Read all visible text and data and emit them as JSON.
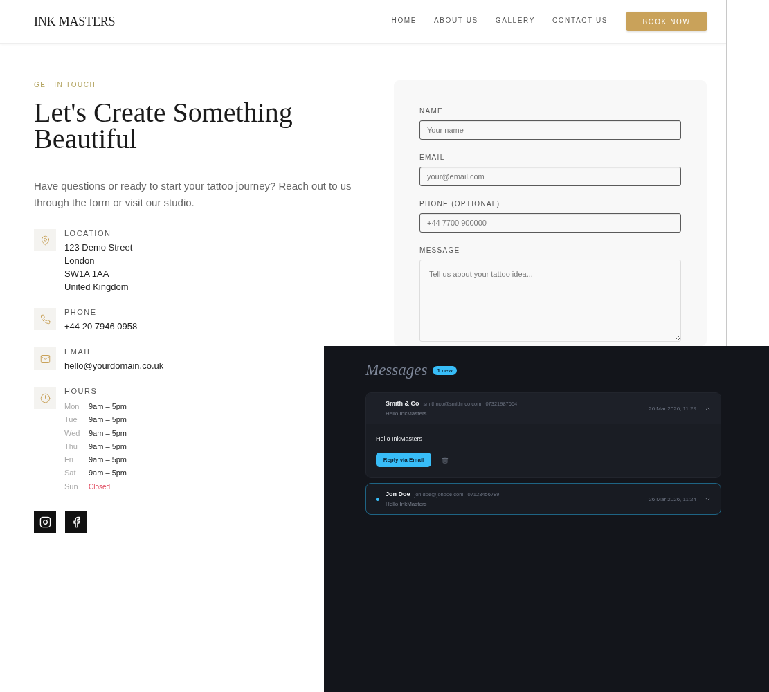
{
  "site": {
    "brand": "INK MASTERS",
    "nav": [
      "HOME",
      "ABOUT US",
      "GALLERY",
      "CONTACT US"
    ],
    "cta": "BOOK NOW",
    "eyebrow": "GET IN TOUCH",
    "heading": "Let's Create Something Beautiful",
    "intro": "Have questions or ready to start your tattoo journey? Reach out to us through the form or visit our studio.",
    "contacts": [
      {
        "kind": "location",
        "label": "LOCATION",
        "lines": [
          "123 Demo Street",
          "London",
          "SW1A 1AA",
          "United Kingdom"
        ]
      },
      {
        "kind": "phone",
        "label": "PHONE",
        "lines": [
          "+44 20 7946 0958"
        ]
      },
      {
        "kind": "email",
        "label": "EMAIL",
        "lines": [
          "hello@yourdomain.co.uk"
        ]
      },
      {
        "kind": "hours",
        "label": "HOURS",
        "hours": [
          {
            "day": "Mon",
            "time": "9am – 5pm",
            "closed": false
          },
          {
            "day": "Tue",
            "time": "9am – 5pm",
            "closed": false
          },
          {
            "day": "Wed",
            "time": "9am – 5pm",
            "closed": false
          },
          {
            "day": "Thu",
            "time": "9am – 5pm",
            "closed": false
          },
          {
            "day": "Fri",
            "time": "9am – 5pm",
            "closed": false
          },
          {
            "day": "Sat",
            "time": "9am – 5pm",
            "closed": false
          },
          {
            "day": "Sun",
            "time": "Closed",
            "closed": true
          }
        ]
      }
    ],
    "social": [
      {
        "kind": "instagram"
      },
      {
        "kind": "facebook"
      }
    ],
    "form": {
      "fields": [
        {
          "kind": "input",
          "label": "NAME",
          "placeholder": "Your name"
        },
        {
          "kind": "input",
          "label": "EMAIL",
          "placeholder": "your@email.com"
        },
        {
          "kind": "input",
          "label": "PHONE (OPTIONAL)",
          "placeholder": "+44 7700 900000"
        },
        {
          "kind": "textarea",
          "label": "MESSAGE",
          "placeholder": "Tell us about your tattoo idea..."
        }
      ]
    }
  },
  "messages": {
    "title": "Messages",
    "badge": "1 new",
    "items": [
      {
        "name": "Smith & Co",
        "email": "smithnco@smithnco.com",
        "phone": "07321987654",
        "preview": "Hello InkMasters",
        "date": "26 Mar 2026, 11:29",
        "expanded": true,
        "unread": false,
        "body": "Hello InkMasters",
        "reply": "Reply via Email"
      },
      {
        "name": "Jon Doe",
        "email": "jon.doe@jondoe.com",
        "phone": "07123456789",
        "preview": "Hello InkMasters",
        "date": "26 Mar 2026, 11:24",
        "expanded": false,
        "unread": true
      }
    ]
  }
}
